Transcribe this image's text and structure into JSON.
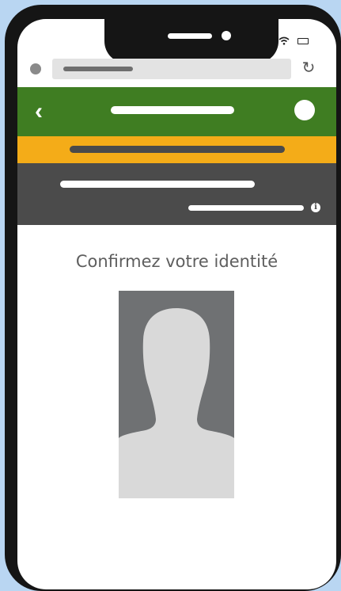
{
  "content": {
    "title": "Confirmez votre identité"
  },
  "icons": {
    "back": "chevron-left-icon",
    "reload": "reload-icon",
    "info": "info-icon",
    "wifi": "wifi-icon",
    "battery": "battery-icon",
    "silhouette": "person-silhouette-icon"
  },
  "colors": {
    "header": "#3f7d22",
    "banner": "#f4ac18",
    "info_panel": "#4b4b4b",
    "photo_bg": "#6f7173",
    "silhouette": "#d9d9d9"
  }
}
